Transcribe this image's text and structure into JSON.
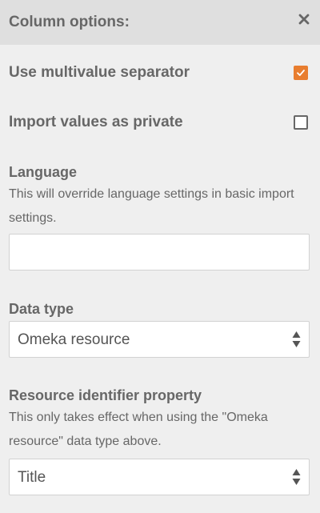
{
  "header": {
    "title": "Column options:"
  },
  "options": {
    "multivalue_label": "Use multivalue separator",
    "multivalue_checked": true,
    "private_label": "Import values as private",
    "private_checked": false
  },
  "language": {
    "label": "Language",
    "help": "This will override language settings in basic import settings.",
    "value": "",
    "placeholder": ""
  },
  "data_type": {
    "label": "Data type",
    "selected": "Omeka resource"
  },
  "resource_identifier": {
    "label": "Resource identifier property",
    "help": "This only takes effect when using the \"Omeka resource\" data type above.",
    "selected": "Title"
  },
  "colors": {
    "accent": "#e87d2f",
    "text": "#676767",
    "header_bg": "#dfdfdf",
    "panel_bg": "#efefef"
  }
}
